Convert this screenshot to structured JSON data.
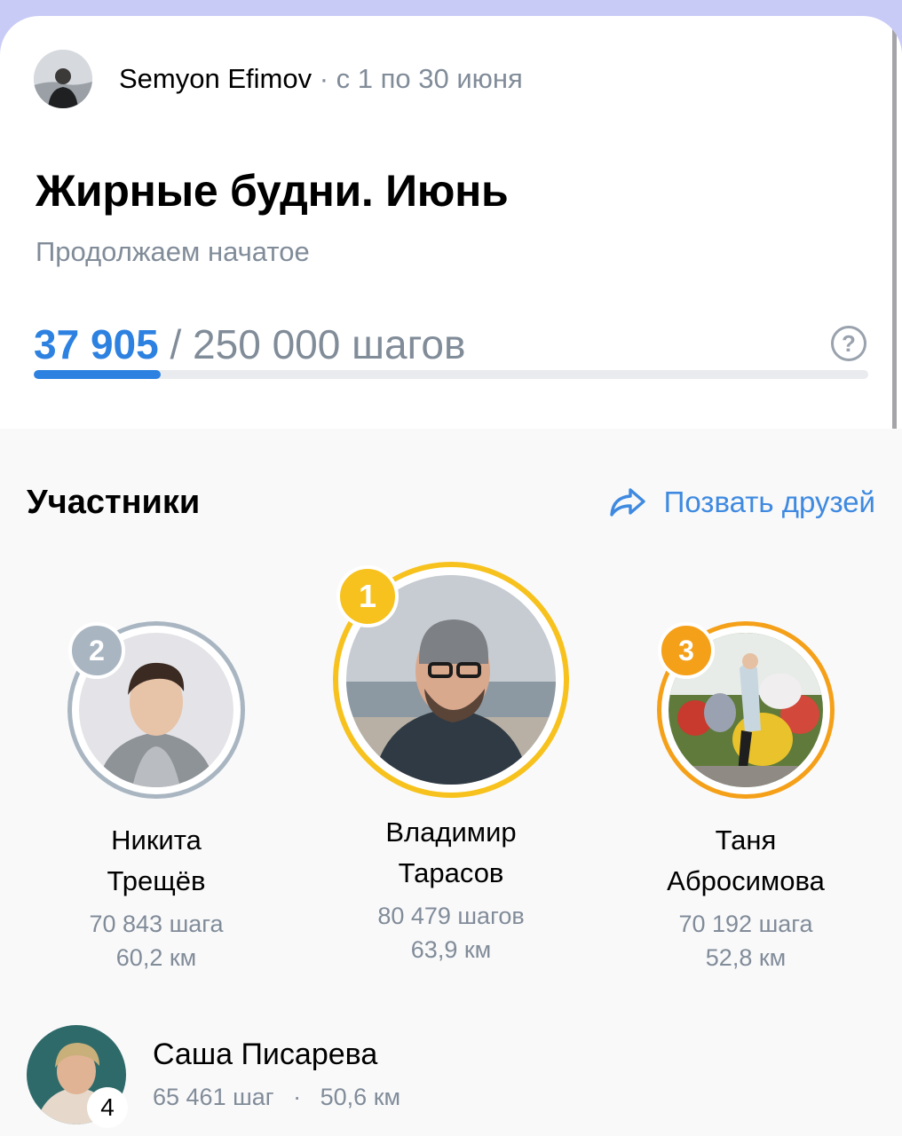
{
  "challenge": {
    "author": "Semyon Efimov",
    "separator": "·",
    "dates": "с 1 по 30 июня",
    "title": "Жирные будни. Июнь",
    "subtitle": "Продолжаем начатое",
    "progress": {
      "current": "37 905",
      "separator": "/",
      "goal": "250 000 шагов",
      "fraction": 0.1516,
      "help_label": "?"
    }
  },
  "participants": {
    "heading": "Участники",
    "invite_label": "Позвать друзей",
    "podium": [
      {
        "rank": "2",
        "name_first": "Никита",
        "name_last": "Трещёв",
        "steps": "70 843 шага",
        "distance": "60,2 км"
      },
      {
        "rank": "1",
        "name_first": "Владимир",
        "name_last": "Тарасов",
        "steps": "80 479 шагов",
        "distance": "63,9 км"
      },
      {
        "rank": "3",
        "name_first": "Таня",
        "name_last": "Абросимова",
        "steps": "70 192 шага",
        "distance": "52,8 км"
      }
    ],
    "list": [
      {
        "rank": "4",
        "name": "Саша Писарева",
        "steps": "65 461 шаг",
        "dot": "·",
        "distance": "50,6 км"
      }
    ]
  },
  "colors": {
    "accent": "#2d81e0",
    "gold": "#f7c21d",
    "silver": "#a9b6c2",
    "bronze": "#f5a019",
    "secondary_text": "#818c99"
  }
}
